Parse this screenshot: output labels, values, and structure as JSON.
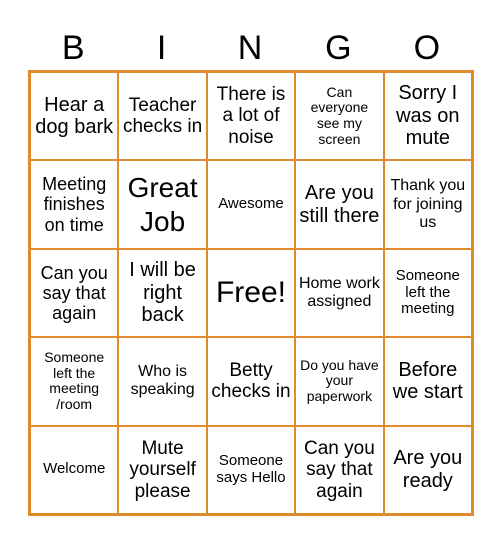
{
  "header": {
    "letters": [
      "B",
      "I",
      "N",
      "G",
      "O"
    ]
  },
  "colors": {
    "grid_line": "#E08A2E",
    "text": "#000000",
    "background": "#FFFFFF"
  },
  "cells": [
    [
      "Hear a dog bark",
      "Teacher checks in",
      "There is a lot of noise",
      "Can everyone see my screen",
      "Sorry I was on mute"
    ],
    [
      "Meeting finishes on time",
      "Great Job",
      "Awesome",
      "Are you still there",
      "Thank you for joining us"
    ],
    [
      "Can you say that again",
      "I will be right back",
      "Free!",
      "Home work assigned",
      "Someone left the meeting"
    ],
    [
      "Someone left the meeting /room",
      "Who is speaking",
      "Betty checks in",
      "Do you have your paperwork",
      "Before we start"
    ],
    [
      "Welcome",
      "Mute yourself please",
      "Someone says Hello",
      "Can you say that again",
      "Are you ready"
    ]
  ]
}
